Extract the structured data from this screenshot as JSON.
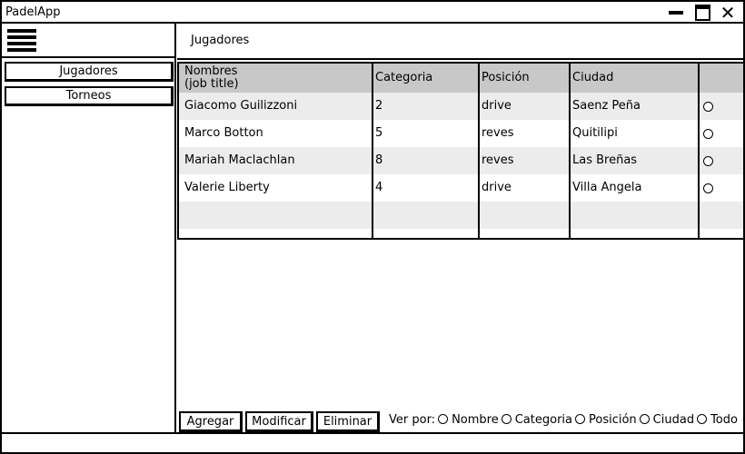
{
  "window": {
    "title": "PadelApp"
  },
  "sidebar": {
    "items": [
      {
        "label": "Jugadores"
      },
      {
        "label": "Torneos"
      }
    ]
  },
  "header": {
    "title": "Jugadores"
  },
  "table": {
    "columns": [
      "Nombres\n(job title)",
      "Categoria",
      "Posición",
      "Ciudad",
      ""
    ],
    "rows": [
      {
        "nombre": "Giacomo Guilizzoni",
        "categoria": "2",
        "posicion": "drive",
        "ciudad": "Saenz Peña"
      },
      {
        "nombre": "Marco Botton",
        "categoria": "5",
        "posicion": "reves",
        "ciudad": "Quitilipi"
      },
      {
        "nombre": "Mariah Maclachlan",
        "categoria": "8",
        "posicion": "reves",
        "ciudad": "Las Breñas"
      },
      {
        "nombre": "Valerie Liberty",
        "categoria": "4",
        "posicion": "drive",
        "ciudad": "Villa Angela"
      }
    ]
  },
  "actions": {
    "add_label": "Agregar",
    "edit_label": "Modificar",
    "delete_label": "Eliminar"
  },
  "filter": {
    "label": "Ver por:",
    "options": [
      "Nombre",
      "Categoria",
      "Posición",
      "Ciudad",
      "Todo"
    ]
  },
  "icons": {
    "menu": "hamburger-icon",
    "minimize": "minimize-icon",
    "maximize": "maximize-icon",
    "close": "close-icon",
    "radio": "radio-icon"
  },
  "colors": {
    "header_bg": "#c8c8c8",
    "row_alt_bg": "#ececec"
  }
}
